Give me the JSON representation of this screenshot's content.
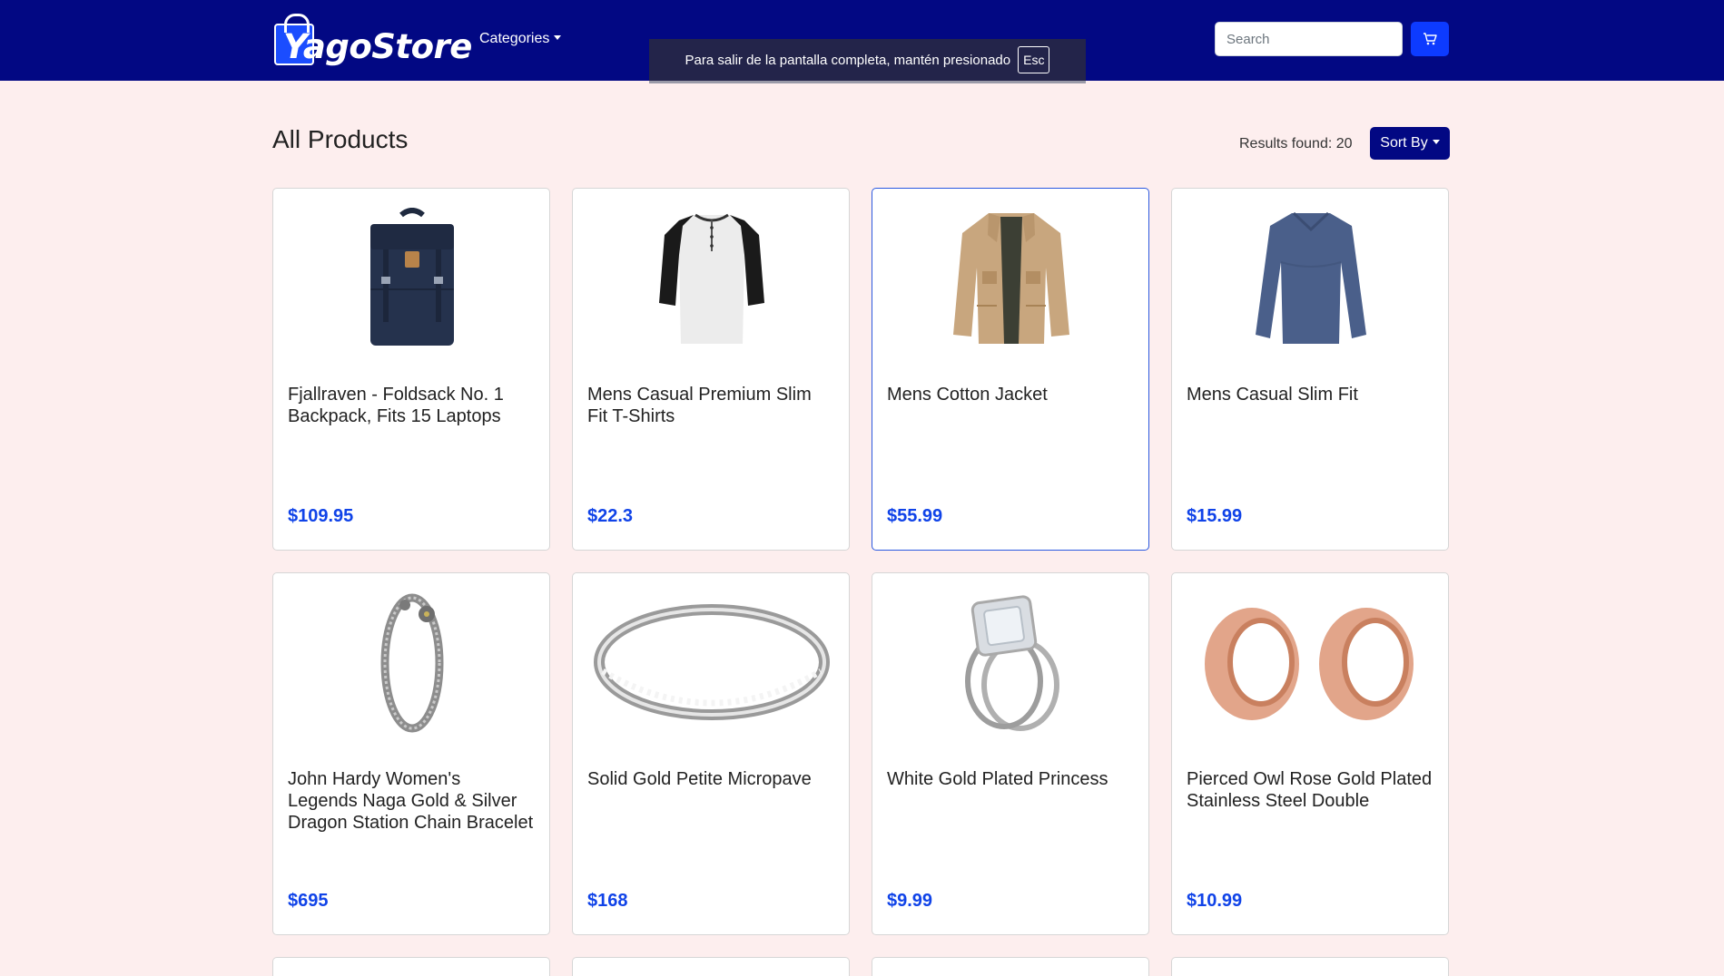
{
  "navbar": {
    "brand": "YagoStore",
    "categories_label": "Categories",
    "search_placeholder": "Search"
  },
  "fullscreen_notice": {
    "text": "Para salir de la pantalla completa, mantén presionado",
    "key": "Esc"
  },
  "header": {
    "title": "All Products",
    "results": "Results found: 20",
    "sort_label": "Sort By"
  },
  "colors": {
    "navbar": "#020883",
    "page_bg": "#fdeeee",
    "price": "#1043e8",
    "cart_button": "#0d3bff"
  },
  "products": [
    {
      "title": "Fjallraven - Foldsack No. 1 Backpack, Fits 15 Laptops",
      "price": "$109.95",
      "icon": "backpack-image"
    },
    {
      "title": "Mens Casual Premium Slim Fit T-Shirts",
      "price": "$22.3",
      "icon": "tshirt-image"
    },
    {
      "title": "Mens Cotton Jacket",
      "price": "$55.99",
      "icon": "jacket-image"
    },
    {
      "title": "Mens Casual Slim Fit",
      "price": "$15.99",
      "icon": "longsleeve-image"
    },
    {
      "title": "John Hardy Women's Legends Naga Gold & Silver Dragon Station Chain Bracelet",
      "price": "$695",
      "icon": "bracelet-image"
    },
    {
      "title": "Solid Gold Petite Micropave",
      "price": "$168",
      "icon": "ring-image"
    },
    {
      "title": "White Gold Plated Princess",
      "price": "$9.99",
      "icon": "diamond-ring-image"
    },
    {
      "title": "Pierced Owl Rose Gold Plated Stainless Steel Double",
      "price": "$10.99",
      "icon": "rose-gold-plugs-image"
    }
  ]
}
